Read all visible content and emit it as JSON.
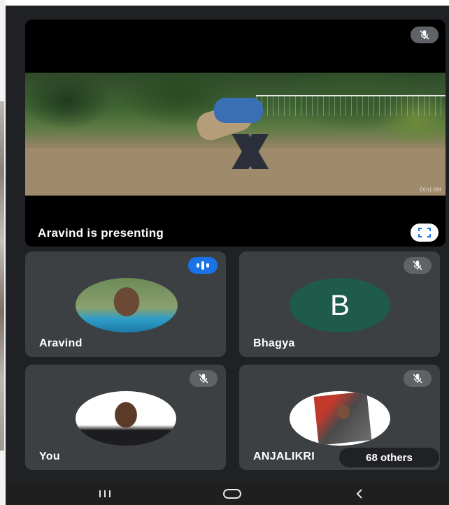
{
  "presentation": {
    "label": "Aravind is presenting",
    "fullscreen_icon": "fullscreen-icon",
    "watermark": "DIALSM"
  },
  "participants": [
    {
      "name": "Aravind",
      "status": "speaking",
      "avatar": "photo"
    },
    {
      "name": "Bhagya",
      "status": "muted",
      "avatar_letter": "B",
      "avatar_color": "#1e5b4a"
    },
    {
      "name": "You",
      "status": "muted",
      "avatar": "photo"
    },
    {
      "name": "ANJALIKRI",
      "status": "muted",
      "avatar": "photo"
    }
  ],
  "others_count": "68 others",
  "navbar": {
    "recents_icon": "recents-icon",
    "home_icon": "home-icon",
    "back_icon": "back-icon"
  },
  "colors": {
    "background": "#202124",
    "tile": "#3c4043",
    "accent": "#1a73e8",
    "badge": "#5f6368"
  }
}
